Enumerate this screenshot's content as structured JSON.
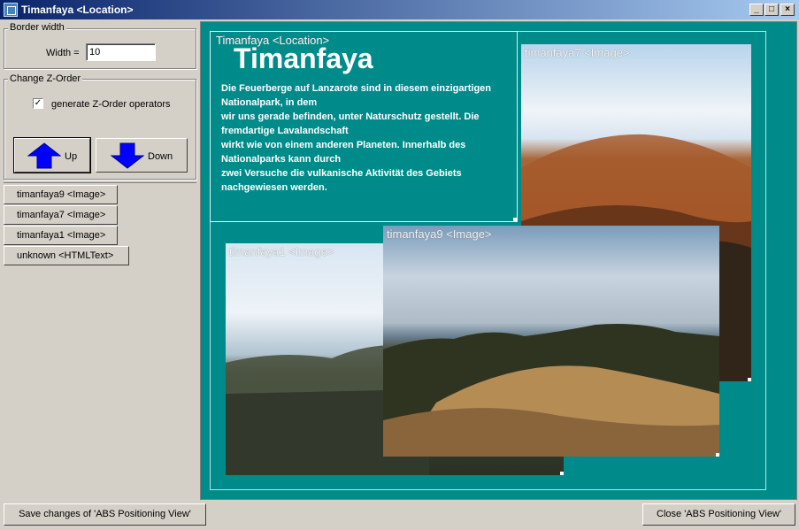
{
  "window": {
    "title": "Timanfaya <Location>",
    "minimize": "_",
    "maximize": "□",
    "close": "×"
  },
  "border_width": {
    "group_label": "Border width",
    "width_label": "Width =",
    "width_value": "10"
  },
  "z_order": {
    "group_label": "Change Z-Order",
    "generate_label": "generate Z-Order operators",
    "generate_checked": "✓",
    "up_label": "Up",
    "down_label": "Down"
  },
  "objects": [
    "timanfaya9 <Image>",
    "timanfaya7 <Image>",
    "timanfaya1 <Image>",
    "unknown <HTMLText>"
  ],
  "canvas": {
    "html_text": {
      "label": "Timanfaya <Location>",
      "title": "Timanfaya",
      "body": "Die Feuerberge auf Lanzarote sind in diesem einzigartigen Nationalpark, in dem\nwir uns gerade befinden, unter Naturschutz gestellt. Die fremdartige Lavalandschaft\nwirkt wie von einem anderen Planeten. Innerhalb des Nationalparks kann durch\nzwei Versuche die vulkanische Aktivität des Gebiets nachgewiesen werden."
    },
    "images": {
      "timanfaya7": "timanfaya7 <Image>",
      "timanfaya1": "timanfaya1 <Image>",
      "timanfaya9": "timanfaya9 <Image>"
    }
  },
  "footer": {
    "save_label": "Save changes of 'ABS Positioning View'",
    "close_label": "Close 'ABS Positioning View'"
  },
  "colors": {
    "canvas": "#008b8b",
    "titlebar_start": "#0a246a",
    "titlebar_end": "#a6caf0",
    "arrow": "#0000ff"
  }
}
